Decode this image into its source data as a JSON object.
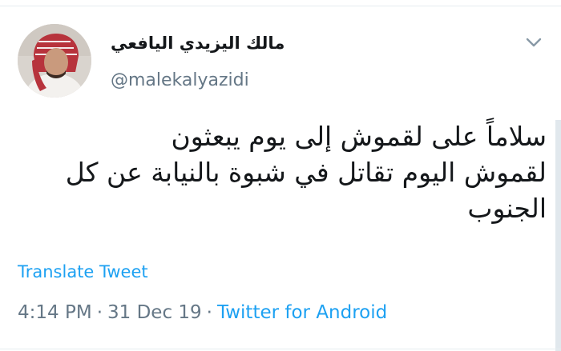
{
  "tweet": {
    "display_name": "مالك اليزيدي اليافعي",
    "handle": "@malekalyazidi",
    "text_lines": [
      "سلاماً على لقموش إلى يوم يبعثون",
      "لقموش اليوم تقاتل في شبوة بالنيابة عن كل",
      "الجنوب"
    ],
    "translate_label": "Translate Tweet",
    "time": "4:14 PM",
    "separator": "·",
    "date": "31 Dec 19",
    "source": "Twitter for Android"
  },
  "icons": {
    "menu": "chevron-down-icon",
    "avatar": "avatar-photo"
  },
  "colors": {
    "link": "#1da1f2",
    "muted": "#657786",
    "text": "#14171a"
  }
}
